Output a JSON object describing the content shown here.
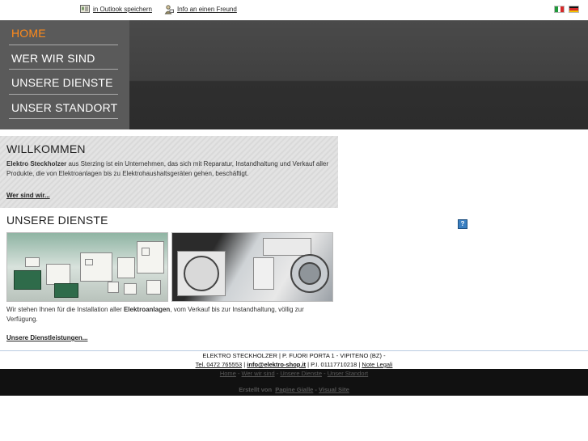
{
  "topbar": {
    "outlook_label": "in Outlook speichern",
    "friend_label": "Info an einen Freund"
  },
  "nav": {
    "items": [
      {
        "label": "HOME"
      },
      {
        "label": "WER WIR SIND"
      },
      {
        "label": "UNSERE DIENSTE"
      },
      {
        "label": "UNSER STANDORT"
      }
    ]
  },
  "welcome": {
    "title": "WILLKOMMEN",
    "company": "Elektro Steckholzer",
    "text": " aus Sterzing ist ein Unternehmen, das sich mit Reparatur, Instandhaltung und Verkauf aller Produkte, die von Elektroanlagen bis zu Elektrohaushaltsgeräten gehen, beschäftigt.",
    "more": "Wer sind wir..."
  },
  "services": {
    "title": "UNSERE DIENSTE",
    "text_before": "Wir stehen Ihnen für die Installation aller ",
    "text_bold": "Elektroanlagen",
    "text_after": ", vom Verkauf bis zur Instandhaltung, völlig zur Verfügung.",
    "more": "Unsere Dienstleistungen..."
  },
  "help_label": "?",
  "footer": {
    "line1": "ELEKTRO STECKHOLZER | P. FUORI PORTA 1 - VIPITENO (BZ) -",
    "tel": "Tel. 0472 765553",
    "email": "info@elektro-shop.it",
    "sep": " | ",
    "pi": "P.I. 01117710218",
    "legal": "Note Legali",
    "nav": [
      "Home",
      "Wer wir sind",
      "Unsere Dienste",
      "Unser Standort"
    ],
    "nav_sep": " - ",
    "credit_prefix": "Erstellt von",
    "credit_link1": "Pagine Gialle",
    "credit_dash": " - ",
    "credit_link2": "Visual Site"
  },
  "colors": {
    "nav_active": "#ff8a1a",
    "nav_bg": "#5a5a5a",
    "header_bg": "#404040",
    "footer_bg": "#111111"
  },
  "icons": {
    "outlook": "outlook-card-icon",
    "friend": "friend-person-icon",
    "flag_it": "flag-italy-icon",
    "flag_de": "flag-germany-icon",
    "help": "help-icon"
  }
}
